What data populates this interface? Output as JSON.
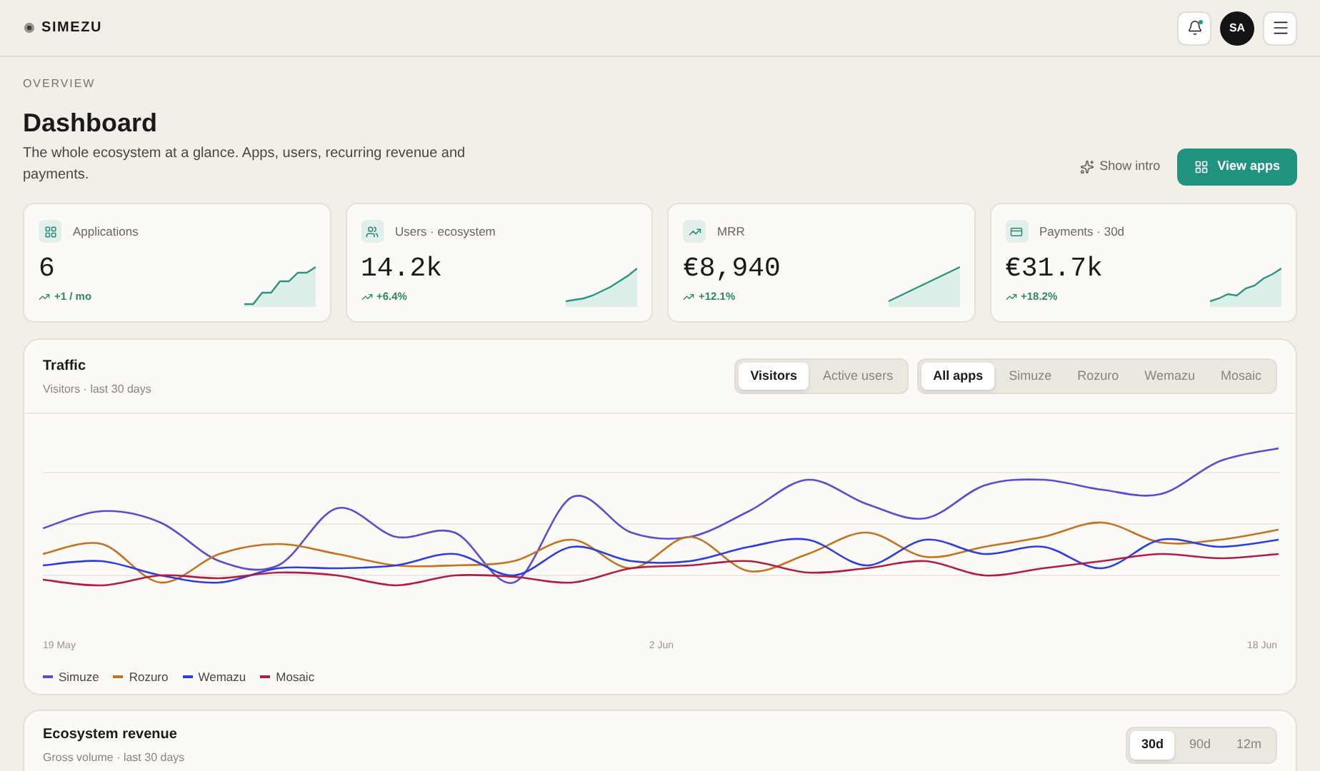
{
  "brand": "SIMEZU",
  "header": {
    "avatar": "SA",
    "notification_dot": true
  },
  "page": {
    "eyebrow": "OVERVIEW",
    "title": "Dashboard",
    "subtitle": "The whole ecosystem at a glance. Apps, users, recurring revenue and payments.",
    "actions": [
      {
        "kind": "ghost",
        "label": "Show intro"
      },
      {
        "kind": "primary",
        "label": "View apps"
      }
    ]
  },
  "stats": [
    {
      "label": "Applications",
      "value": "6",
      "change": "+1 / mo"
    },
    {
      "label": "Users · ecosystem",
      "value": "14.2k",
      "change": "+6.4%"
    },
    {
      "label": "MRR",
      "value": "€8,940",
      "change": "+12.1%"
    },
    {
      "label": "Payments · 30d",
      "value": "€31.7k",
      "change": "+18.2%"
    }
  ],
  "traffic": {
    "title": "Traffic",
    "subtitle": "Visitors · last 30 days",
    "metric_tabs": [
      {
        "label": "Visitors",
        "selected": true
      },
      {
        "label": "Active users",
        "selected": false
      }
    ],
    "app_tabs": [
      {
        "label": "All apps",
        "selected": true
      },
      {
        "label": "Simuze",
        "selected": false
      },
      {
        "label": "Rozuro",
        "selected": false
      },
      {
        "label": "Wemazu",
        "selected": false
      },
      {
        "label": "Mosaic",
        "selected": false
      }
    ],
    "x_labels": [
      "19 May",
      "2 Jun",
      "18 Jun"
    ],
    "legend": [
      {
        "name": "Simuze",
        "color": "#5b4cd4"
      },
      {
        "name": "Rozuro",
        "color": "#c4721f"
      },
      {
        "name": "Wemazu",
        "color": "#2b3ee0"
      },
      {
        "name": "Mosaic",
        "color": "#b01e44"
      }
    ]
  },
  "revenue": {
    "title": "Ecosystem revenue",
    "subtitle": "Gross volume · last 30 days",
    "range_tabs": [
      {
        "label": "30d",
        "selected": true
      },
      {
        "label": "90d",
        "selected": false
      },
      {
        "label": "12m",
        "selected": false
      }
    ]
  }
}
